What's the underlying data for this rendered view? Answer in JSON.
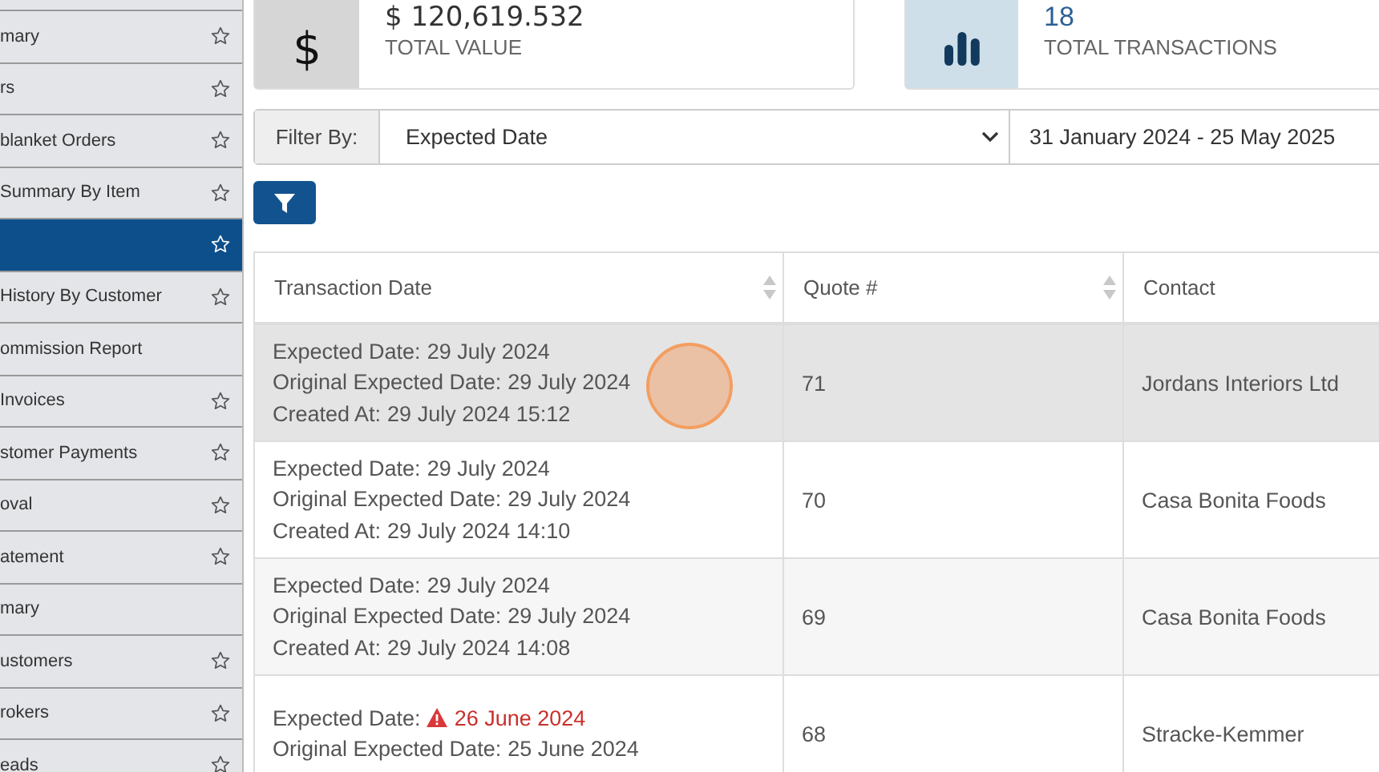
{
  "sidebar": {
    "items": [
      {
        "label": "mary",
        "selected": false,
        "star": true
      },
      {
        "label": "rs",
        "selected": false,
        "star": true
      },
      {
        "label": "blanket Orders",
        "selected": false,
        "star": true
      },
      {
        "label": "Summary By Item",
        "selected": false,
        "star": true
      },
      {
        "selected": true,
        "star": true
      },
      {
        "label": "History By Customer",
        "selected": false,
        "star": true
      },
      {
        "label": "ommission Report",
        "selected": false,
        "star": false
      },
      {
        "label": "Invoices",
        "selected": false,
        "star": true
      },
      {
        "label": "stomer Payments",
        "selected": false,
        "star": true
      },
      {
        "label": "oval",
        "selected": false,
        "star": true
      },
      {
        "label": "atement",
        "selected": false,
        "star": true
      },
      {
        "label": "mary",
        "selected": false,
        "star": false
      },
      {
        "label": "ustomers",
        "selected": false,
        "star": true
      },
      {
        "label": "rokers",
        "selected": false,
        "star": true
      },
      {
        "label": "eads",
        "selected": false,
        "star": true
      }
    ]
  },
  "stats": [
    {
      "kind": "dollar",
      "icon": "$",
      "value": "$ 120,619.532",
      "label": "TOTAL VALUE"
    },
    {
      "kind": "bars",
      "value": "18",
      "label": "TOTAL TRANSACTIONS"
    }
  ],
  "filter": {
    "label": "Filter By:",
    "value": "Expected Date",
    "date_range": "31 January 2024 - 25 May 2025"
  },
  "table": {
    "columns": [
      {
        "label": "Transaction Date",
        "sortable": true
      },
      {
        "label": "Quote #",
        "sortable": true
      },
      {
        "label": "Contact"
      }
    ],
    "rows": [
      {
        "hovered": true,
        "lines": [
          {
            "label": "Expected Date:",
            "value": "29 July 2024",
            "warning": false
          },
          {
            "label": "Original Expected Date:",
            "value": "29 July 2024",
            "warning": false
          },
          {
            "label": "Created At:",
            "value": "29 July 2024 15:12",
            "warning": false
          }
        ],
        "quote": "71",
        "contact": "Jordans Interiors Ltd"
      },
      {
        "hovered": false,
        "lines": [
          {
            "label": "Expected Date:",
            "value": "29 July 2024",
            "warning": false
          },
          {
            "label": "Original Expected Date:",
            "value": "29 July 2024",
            "warning": false
          },
          {
            "label": "Created At:",
            "value": "29 July 2024 14:10",
            "warning": false
          }
        ],
        "quote": "70",
        "contact": "Casa Bonita Foods"
      },
      {
        "hovered": false,
        "lines": [
          {
            "label": "Expected Date:",
            "value": "29 July 2024",
            "warning": false
          },
          {
            "label": "Original Expected Date:",
            "value": "29 July 2024",
            "warning": false
          },
          {
            "label": "Created At:",
            "value": "29 July 2024 14:08",
            "warning": false
          }
        ],
        "quote": "69",
        "contact": "Casa Bonita Foods"
      },
      {
        "hovered": false,
        "lines": [
          {
            "label": "Expected Date:",
            "value": "26 June 2024",
            "warning": true
          },
          {
            "label": "Original Expected Date:",
            "value": "25 June 2024",
            "warning": false
          }
        ],
        "quote": "68",
        "contact": "Stracke-Kemmer"
      }
    ]
  }
}
